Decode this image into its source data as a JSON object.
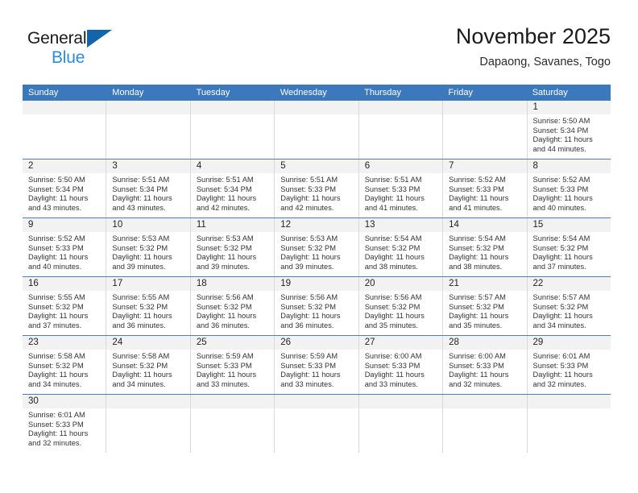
{
  "brand": {
    "name_dark": "General",
    "name_blue": "Blue",
    "accent_blue": "#1464aa",
    "light_blue": "#2e8bd8"
  },
  "header": {
    "title": "November 2025",
    "subtitle": "Dapaong, Savanes, Togo"
  },
  "calendar": {
    "header_bg": "#3c78bc",
    "weekdays": [
      "Sunday",
      "Monday",
      "Tuesday",
      "Wednesday",
      "Thursday",
      "Friday",
      "Saturday"
    ],
    "weeks": [
      [
        {
          "empty": true
        },
        {
          "empty": true
        },
        {
          "empty": true
        },
        {
          "empty": true
        },
        {
          "empty": true
        },
        {
          "empty": true
        },
        {
          "day": "1",
          "sunrise": "Sunrise: 5:50 AM",
          "sunset": "Sunset: 5:34 PM",
          "daylight1": "Daylight: 11 hours",
          "daylight2": "and 44 minutes."
        }
      ],
      [
        {
          "day": "2",
          "sunrise": "Sunrise: 5:50 AM",
          "sunset": "Sunset: 5:34 PM",
          "daylight1": "Daylight: 11 hours",
          "daylight2": "and 43 minutes."
        },
        {
          "day": "3",
          "sunrise": "Sunrise: 5:51 AM",
          "sunset": "Sunset: 5:34 PM",
          "daylight1": "Daylight: 11 hours",
          "daylight2": "and 43 minutes."
        },
        {
          "day": "4",
          "sunrise": "Sunrise: 5:51 AM",
          "sunset": "Sunset: 5:34 PM",
          "daylight1": "Daylight: 11 hours",
          "daylight2": "and 42 minutes."
        },
        {
          "day": "5",
          "sunrise": "Sunrise: 5:51 AM",
          "sunset": "Sunset: 5:33 PM",
          "daylight1": "Daylight: 11 hours",
          "daylight2": "and 42 minutes."
        },
        {
          "day": "6",
          "sunrise": "Sunrise: 5:51 AM",
          "sunset": "Sunset: 5:33 PM",
          "daylight1": "Daylight: 11 hours",
          "daylight2": "and 41 minutes."
        },
        {
          "day": "7",
          "sunrise": "Sunrise: 5:52 AM",
          "sunset": "Sunset: 5:33 PM",
          "daylight1": "Daylight: 11 hours",
          "daylight2": "and 41 minutes."
        },
        {
          "day": "8",
          "sunrise": "Sunrise: 5:52 AM",
          "sunset": "Sunset: 5:33 PM",
          "daylight1": "Daylight: 11 hours",
          "daylight2": "and 40 minutes."
        }
      ],
      [
        {
          "day": "9",
          "sunrise": "Sunrise: 5:52 AM",
          "sunset": "Sunset: 5:33 PM",
          "daylight1": "Daylight: 11 hours",
          "daylight2": "and 40 minutes."
        },
        {
          "day": "10",
          "sunrise": "Sunrise: 5:53 AM",
          "sunset": "Sunset: 5:32 PM",
          "daylight1": "Daylight: 11 hours",
          "daylight2": "and 39 minutes."
        },
        {
          "day": "11",
          "sunrise": "Sunrise: 5:53 AM",
          "sunset": "Sunset: 5:32 PM",
          "daylight1": "Daylight: 11 hours",
          "daylight2": "and 39 minutes."
        },
        {
          "day": "12",
          "sunrise": "Sunrise: 5:53 AM",
          "sunset": "Sunset: 5:32 PM",
          "daylight1": "Daylight: 11 hours",
          "daylight2": "and 39 minutes."
        },
        {
          "day": "13",
          "sunrise": "Sunrise: 5:54 AM",
          "sunset": "Sunset: 5:32 PM",
          "daylight1": "Daylight: 11 hours",
          "daylight2": "and 38 minutes."
        },
        {
          "day": "14",
          "sunrise": "Sunrise: 5:54 AM",
          "sunset": "Sunset: 5:32 PM",
          "daylight1": "Daylight: 11 hours",
          "daylight2": "and 38 minutes."
        },
        {
          "day": "15",
          "sunrise": "Sunrise: 5:54 AM",
          "sunset": "Sunset: 5:32 PM",
          "daylight1": "Daylight: 11 hours",
          "daylight2": "and 37 minutes."
        }
      ],
      [
        {
          "day": "16",
          "sunrise": "Sunrise: 5:55 AM",
          "sunset": "Sunset: 5:32 PM",
          "daylight1": "Daylight: 11 hours",
          "daylight2": "and 37 minutes."
        },
        {
          "day": "17",
          "sunrise": "Sunrise: 5:55 AM",
          "sunset": "Sunset: 5:32 PM",
          "daylight1": "Daylight: 11 hours",
          "daylight2": "and 36 minutes."
        },
        {
          "day": "18",
          "sunrise": "Sunrise: 5:56 AM",
          "sunset": "Sunset: 5:32 PM",
          "daylight1": "Daylight: 11 hours",
          "daylight2": "and 36 minutes."
        },
        {
          "day": "19",
          "sunrise": "Sunrise: 5:56 AM",
          "sunset": "Sunset: 5:32 PM",
          "daylight1": "Daylight: 11 hours",
          "daylight2": "and 36 minutes."
        },
        {
          "day": "20",
          "sunrise": "Sunrise: 5:56 AM",
          "sunset": "Sunset: 5:32 PM",
          "daylight1": "Daylight: 11 hours",
          "daylight2": "and 35 minutes."
        },
        {
          "day": "21",
          "sunrise": "Sunrise: 5:57 AM",
          "sunset": "Sunset: 5:32 PM",
          "daylight1": "Daylight: 11 hours",
          "daylight2": "and 35 minutes."
        },
        {
          "day": "22",
          "sunrise": "Sunrise: 5:57 AM",
          "sunset": "Sunset: 5:32 PM",
          "daylight1": "Daylight: 11 hours",
          "daylight2": "and 34 minutes."
        }
      ],
      [
        {
          "day": "23",
          "sunrise": "Sunrise: 5:58 AM",
          "sunset": "Sunset: 5:32 PM",
          "daylight1": "Daylight: 11 hours",
          "daylight2": "and 34 minutes."
        },
        {
          "day": "24",
          "sunrise": "Sunrise: 5:58 AM",
          "sunset": "Sunset: 5:32 PM",
          "daylight1": "Daylight: 11 hours",
          "daylight2": "and 34 minutes."
        },
        {
          "day": "25",
          "sunrise": "Sunrise: 5:59 AM",
          "sunset": "Sunset: 5:33 PM",
          "daylight1": "Daylight: 11 hours",
          "daylight2": "and 33 minutes."
        },
        {
          "day": "26",
          "sunrise": "Sunrise: 5:59 AM",
          "sunset": "Sunset: 5:33 PM",
          "daylight1": "Daylight: 11 hours",
          "daylight2": "and 33 minutes."
        },
        {
          "day": "27",
          "sunrise": "Sunrise: 6:00 AM",
          "sunset": "Sunset: 5:33 PM",
          "daylight1": "Daylight: 11 hours",
          "daylight2": "and 33 minutes."
        },
        {
          "day": "28",
          "sunrise": "Sunrise: 6:00 AM",
          "sunset": "Sunset: 5:33 PM",
          "daylight1": "Daylight: 11 hours",
          "daylight2": "and 32 minutes."
        },
        {
          "day": "29",
          "sunrise": "Sunrise: 6:01 AM",
          "sunset": "Sunset: 5:33 PM",
          "daylight1": "Daylight: 11 hours",
          "daylight2": "and 32 minutes."
        }
      ],
      [
        {
          "day": "30",
          "sunrise": "Sunrise: 6:01 AM",
          "sunset": "Sunset: 5:33 PM",
          "daylight1": "Daylight: 11 hours",
          "daylight2": "and 32 minutes."
        },
        {
          "empty": true
        },
        {
          "empty": true
        },
        {
          "empty": true
        },
        {
          "empty": true
        },
        {
          "empty": true
        },
        {
          "empty": true
        }
      ]
    ]
  }
}
